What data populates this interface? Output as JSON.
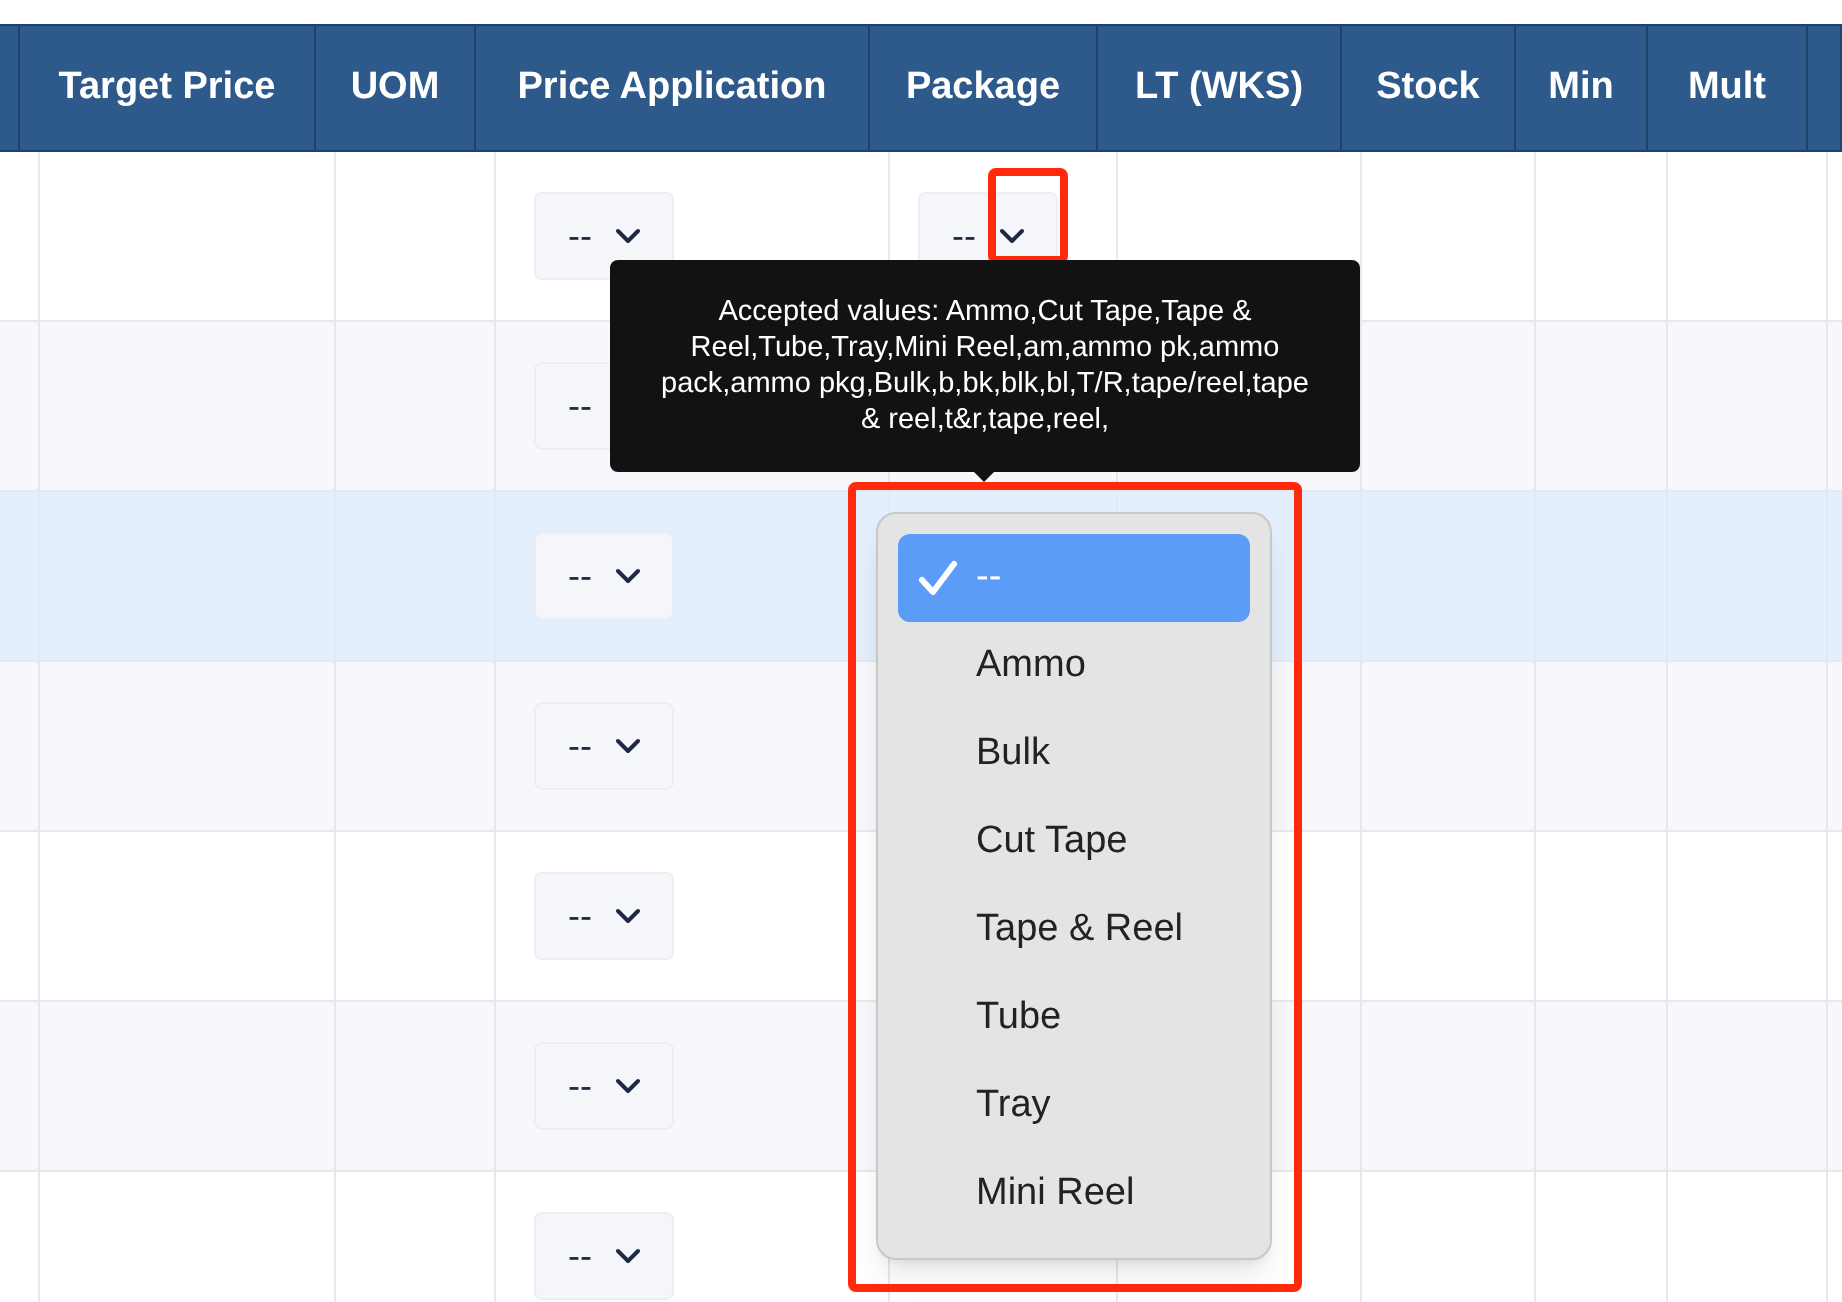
{
  "table": {
    "columns": [
      "",
      "Target Price",
      "UOM",
      "Price Application",
      "Package",
      "LT (WKS)",
      "Stock",
      "Min",
      "Mult",
      ""
    ],
    "rows": [
      {
        "selected": false,
        "price_application": "--",
        "package": "--"
      },
      {
        "selected": false,
        "price_application": "--"
      },
      {
        "selected": true,
        "price_application": "--"
      },
      {
        "selected": false,
        "price_application": "--"
      },
      {
        "selected": false,
        "price_application": "--"
      },
      {
        "selected": false,
        "price_application": "--"
      },
      {
        "selected": false,
        "price_application": "--"
      }
    ]
  },
  "tooltip": {
    "text": "Accepted values: Ammo,Cut Tape,Tape & Reel,Tube,Tray,Mini Reel,am,ammo pk,ammo pack,ammo pkg,Bulk,b,bk,blk,bl,T/R,tape/reel,tape & reel,t&r,tape,reel,"
  },
  "dropdown": {
    "options": [
      {
        "label": "--",
        "selected": true
      },
      {
        "label": "Ammo",
        "selected": false
      },
      {
        "label": "Bulk",
        "selected": false
      },
      {
        "label": "Cut Tape",
        "selected": false
      },
      {
        "label": "Tape & Reel",
        "selected": false
      },
      {
        "label": "Tube",
        "selected": false
      },
      {
        "label": "Tray",
        "selected": false
      },
      {
        "label": "Mini Reel",
        "selected": false
      }
    ]
  }
}
